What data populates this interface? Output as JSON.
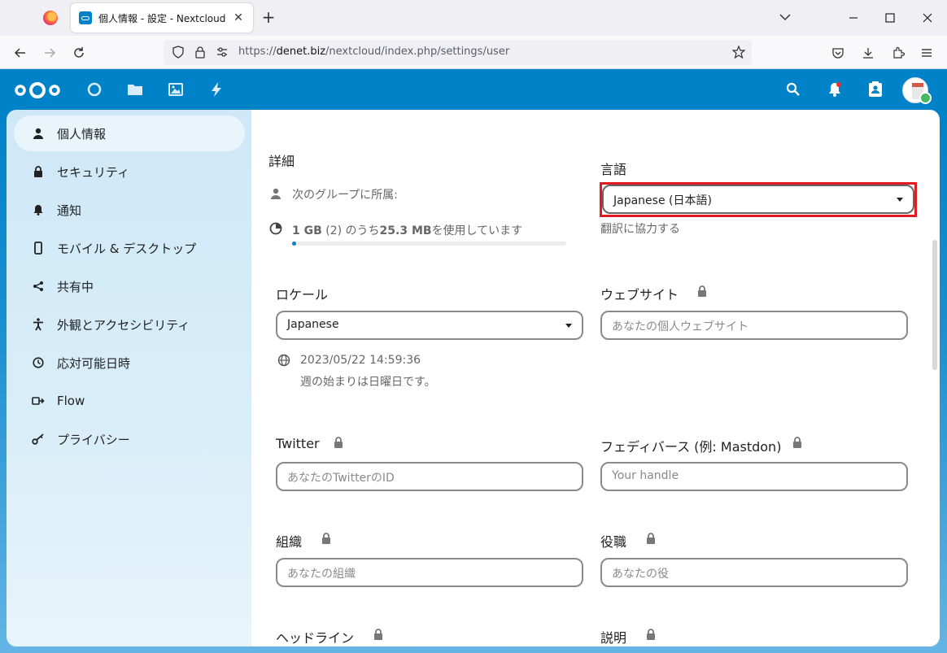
{
  "browser": {
    "tab_title": "個人情報 - 設定 - Nextcloud",
    "url_prefix": "https://",
    "url_domain": "denet.biz",
    "url_path": "/nextcloud/index.php/settings/user"
  },
  "colors": {
    "brand": "#0082c9",
    "highlight": "#e21b22",
    "status_online": "#46ba61"
  },
  "header": {
    "apps": [
      "dashboard-icon",
      "files-icon",
      "photos-icon",
      "activity-icon"
    ],
    "right_icons": [
      "search-icon",
      "notifications-icon",
      "contacts-icon",
      "avatar"
    ]
  },
  "sidebar": {
    "items": [
      {
        "label": "個人情報",
        "icon": "user-icon",
        "active": true
      },
      {
        "label": "セキュリティ",
        "icon": "lock-icon"
      },
      {
        "label": "通知",
        "icon": "bell-icon"
      },
      {
        "label": "モバイル & デスクトップ",
        "icon": "phone-icon"
      },
      {
        "label": "共有中",
        "icon": "share-icon"
      },
      {
        "label": "外観とアクセシビリティ",
        "icon": "accessibility-icon"
      },
      {
        "label": "応対可能日時",
        "icon": "clock-icon"
      },
      {
        "label": "Flow",
        "icon": "flow-icon"
      },
      {
        "label": "プライバシー",
        "icon": "key-icon"
      }
    ]
  },
  "main": {
    "details": {
      "title": "詳細",
      "groups_label": "次のグループに所属:",
      "quota_total": "1 GB",
      "quota_count": "(2)",
      "quota_middle": " のうち",
      "quota_used": "25.3 MB",
      "quota_suffix": "を使用しています",
      "quota_percent": 1.5
    },
    "language": {
      "title": "言語",
      "value": "Japanese (日本語)",
      "help_link": "翻訳に協力する"
    },
    "locale": {
      "title": "ロケール",
      "value": "Japanese",
      "datetime": "2023/05/22 14:59:36",
      "week_start": "週の始まりは日曜日です。"
    },
    "website": {
      "title": "ウェブサイト",
      "placeholder": "あなたの個人ウェブサイト"
    },
    "twitter": {
      "title": "Twitter",
      "placeholder": "あなたのTwitterのID"
    },
    "fediverse": {
      "title": "フェディバース (例: Mastdon)",
      "placeholder": "Your handle"
    },
    "organisation": {
      "title": "組織",
      "placeholder": "あなたの組織"
    },
    "role": {
      "title": "役職",
      "placeholder": "あなたの役"
    },
    "headline": {
      "title": "ヘッドライン"
    },
    "biography": {
      "title": "説明"
    }
  }
}
